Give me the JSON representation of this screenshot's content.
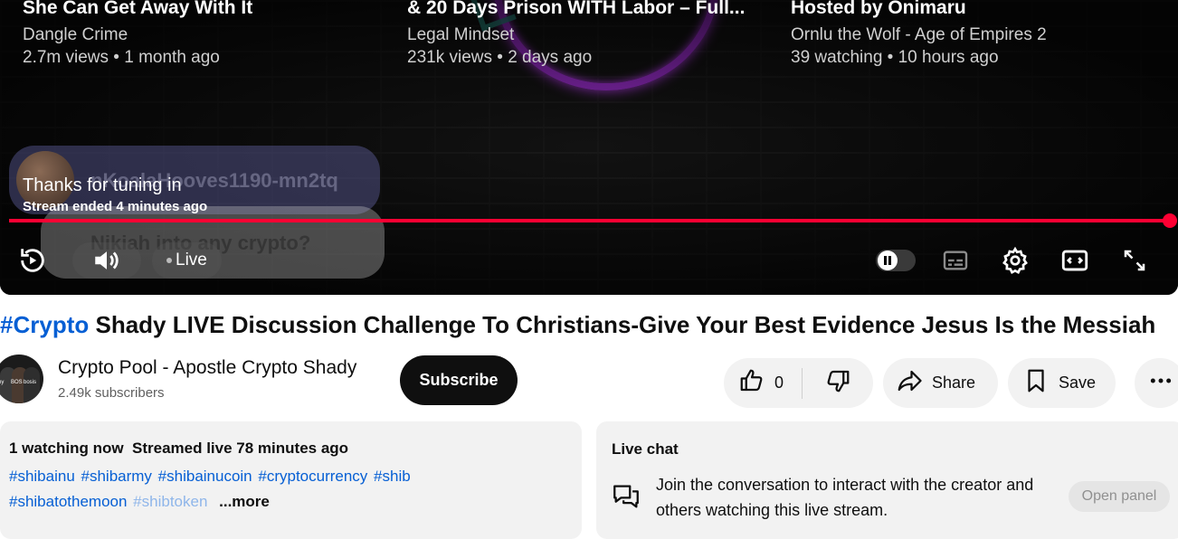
{
  "player": {
    "endcards": [
      {
        "title": "She Can Get Away With It",
        "channel": "Dangle Crime",
        "meta": "2.7m views • 1 month ago"
      },
      {
        "title": "& 20 Days Prison WITH Labor – Full...",
        "channel": "Legal Mindset",
        "meta": "231k views • 2 days ago"
      },
      {
        "title": "Hosted by Onimaru",
        "channel": "Ornlu the Wolf - Age of Empires 2",
        "meta": "39 watching • 10 hours ago"
      }
    ],
    "ghost_chat": {
      "username": "nKoalaHooves1190-mn2tq",
      "message": "Nikiah into any crypto?"
    },
    "status_title": "Thanks for tuning in",
    "status_sub": "Stream ended 4 minutes ago",
    "progress": 1.0,
    "live_label": "Live",
    "autoplay_on": true
  },
  "video": {
    "title_hashtag": "#Crypto",
    "title_rest": " Shady LIVE Discussion Challenge To Christians-Give Your Best Evidence Jesus Is the Messiah"
  },
  "channel": {
    "name": "Crypto Pool - Apostle Crypto Shady",
    "subscribers": "2.49k subscribers",
    "subscribe_label": "Subscribe",
    "avatar_tags": [
      "oy",
      "BOS",
      "bosis"
    ]
  },
  "actions": {
    "like_count": "0",
    "share_label": "Share",
    "save_label": "Save"
  },
  "description": {
    "meta": "1 watching now  Streamed live 78 minutes ago",
    "tags": [
      "#shibainu",
      "#shibarmy",
      "#shibainucoin",
      "#cryptocurrency",
      "#shib",
      "#shibatothemoon",
      "#shibtoken"
    ],
    "more_label": "...more"
  },
  "live_chat": {
    "title": "Live chat",
    "text": "Join the conversation to interact with the creator and others watching this live stream.",
    "open_label": "Open panel"
  },
  "colors": {
    "accent_red": "#ff0033",
    "link_blue": "#065fd4",
    "neon_purple": "#a02bd6"
  }
}
